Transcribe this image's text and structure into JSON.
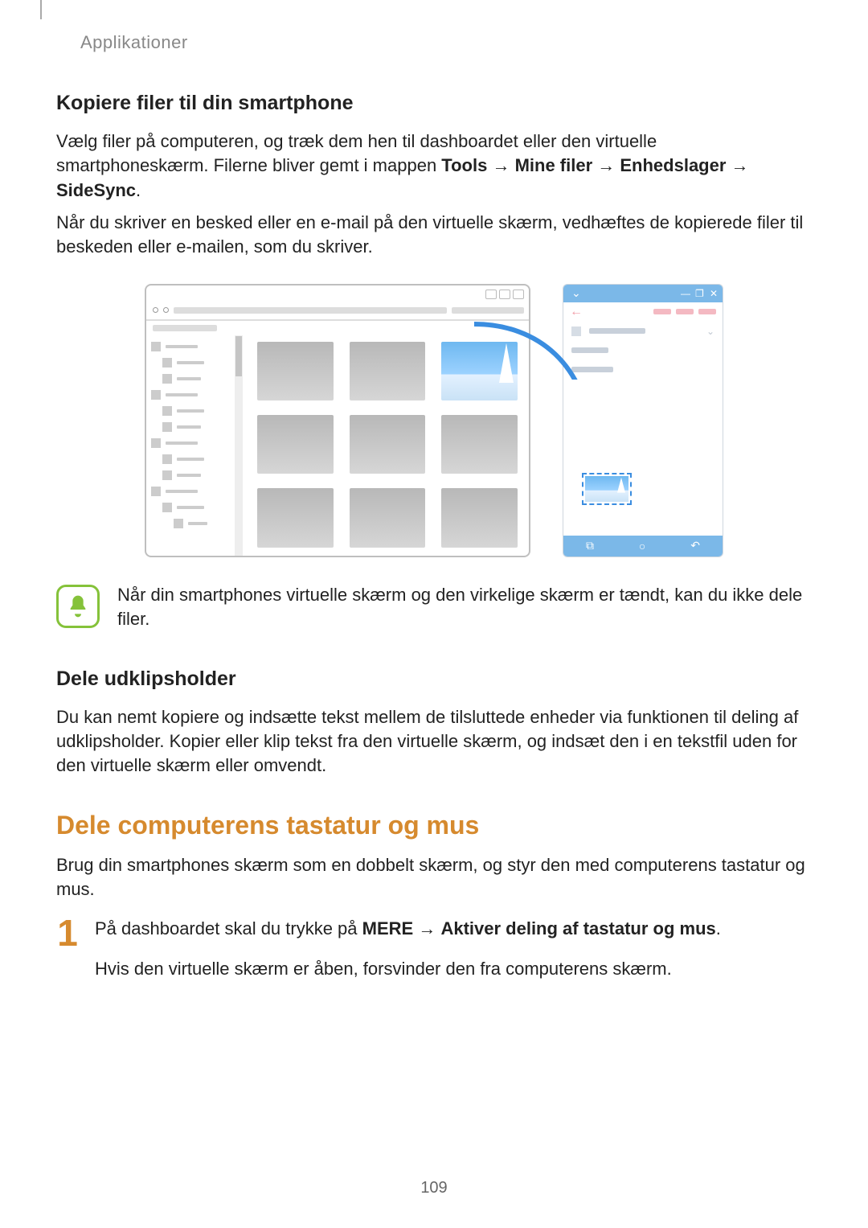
{
  "chapter": "Applikationer",
  "sec1": {
    "heading": "Kopiere filer til din smartphone",
    "p1a": "Vælg filer på computeren, og træk dem hen til dashboardet eller den virtuelle smartphoneskærm. Filerne bliver gemt i mappen ",
    "p1_tools": "Tools",
    "p1_arrow": " → ",
    "p1_mine": "Mine filer",
    "p1_enh": "Enhedslager",
    "p1_side": "SideSync",
    "p1_end": ".",
    "p2": "Når du skriver en besked eller en e-mail på den virtuelle skærm, vedhæftes de kopierede filer til beskeden eller e-mailen, som du skriver."
  },
  "note": "Når din smartphones virtuelle skærm og den virkelige skærm er tændt, kan du ikke dele filer.",
  "sec2": {
    "heading": "Dele udklipsholder",
    "p": "Du kan nemt kopiere og indsætte tekst mellem de tilsluttede enheder via funktionen til deling af udklipsholder. Kopier eller klip tekst fra den virtuelle skærm, og indsæt den i en tekstfil uden for den virtuelle skærm eller omvendt."
  },
  "sec3": {
    "heading": "Dele computerens tastatur og mus",
    "p": "Brug din smartphones skærm som en dobbelt skærm, og styr den med computerens tastatur og mus.",
    "step_no": "1",
    "step1a": "På dashboardet skal du trykke på ",
    "step1_mere": "MERE",
    "step1_arrow": " → ",
    "step1_akt": "Aktiver deling af tastatur og mus",
    "step1_end": ".",
    "step1b": "Hvis den virtuelle skærm er åben, forsvinder den fra computerens skærm."
  },
  "glyphs": {
    "chev": "⌄",
    "back": "←",
    "min": "—",
    "sq": "❐",
    "x": "✕",
    "tab": "⧉",
    "home": "○",
    "backnav": "↶"
  },
  "page": "109"
}
